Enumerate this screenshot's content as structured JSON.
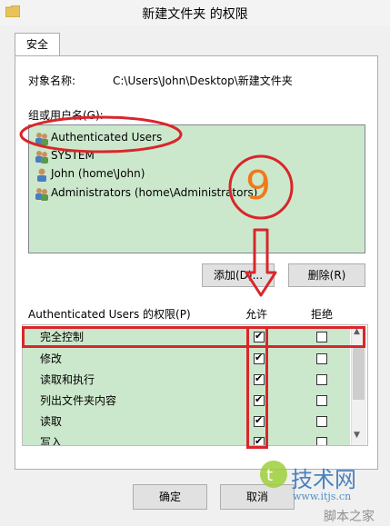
{
  "window": {
    "title": "新建文件夹 的权限"
  },
  "tabs": [
    {
      "label": "安全"
    }
  ],
  "object": {
    "label": "对象名称:",
    "value": "C:\\Users\\John\\Desktop\\新建文件夹"
  },
  "group": {
    "label": "组或用户名(G):",
    "items": [
      {
        "label": "Authenticated Users",
        "icon": "users-icon"
      },
      {
        "label": "SYSTEM",
        "icon": "users-icon"
      },
      {
        "label": "John (home\\John)",
        "icon": "user-icon"
      },
      {
        "label": "Administrators (home\\Administrators)",
        "icon": "users-icon"
      }
    ]
  },
  "buttons": {
    "add": "添加(D)...",
    "remove": "删除(R)",
    "ok": "确定",
    "cancel": "取消"
  },
  "permissions": {
    "label": "Authenticated Users 的权限(P)",
    "allow_header": "允许",
    "deny_header": "拒绝",
    "rows": [
      {
        "name": "完全控制",
        "allow": true,
        "deny": false
      },
      {
        "name": "修改",
        "allow": true,
        "deny": false
      },
      {
        "name": "读取和执行",
        "allow": true,
        "deny": false
      },
      {
        "name": "列出文件夹内容",
        "allow": true,
        "deny": false
      },
      {
        "name": "读取",
        "allow": true,
        "deny": false
      },
      {
        "name": "写入",
        "allow": true,
        "deny": false
      }
    ]
  },
  "annotation": {
    "step_number": "9",
    "color": "#d9262b",
    "number_color": "#f07a1a"
  },
  "watermark": {
    "brand": "技术网",
    "url": "www.itjs.cn",
    "corner": "脚本之家"
  }
}
